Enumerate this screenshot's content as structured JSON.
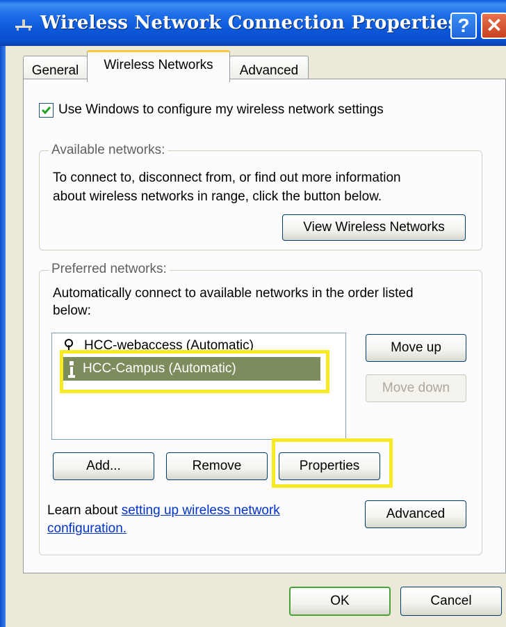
{
  "window": {
    "title": "Wireless Network Connection Properties",
    "help_glyph": "?",
    "close_glyph": "✕"
  },
  "tabs": [
    {
      "label": "General",
      "active": false
    },
    {
      "label": "Wireless Networks",
      "active": true
    },
    {
      "label": "Advanced",
      "active": false
    }
  ],
  "config_checkbox": {
    "label": "Use Windows to configure my wireless network settings",
    "checked": true
  },
  "available": {
    "legend": "Available networks:",
    "line1": "To connect to, disconnect from, or find out more information",
    "line2": "about wireless networks in range, click the button below.",
    "button": "View Wireless Networks"
  },
  "preferred": {
    "legend": "Preferred networks:",
    "line1": "Automatically connect to available networks in the order listed",
    "line2": "below:",
    "networks": [
      {
        "name": "HCC-webaccess (Automatic)",
        "icon": "network-signal-icon",
        "selected": false
      },
      {
        "name": "HCC-Campus (Automatic)",
        "icon": "network-antenna-icon",
        "selected": true
      }
    ],
    "move_up": "Move up",
    "move_down": "Move down",
    "add": "Add...",
    "remove": "Remove",
    "properties": "Properties",
    "learn_prefix": "Learn about ",
    "learn_link_line1": "setting up wireless network",
    "learn_link_line2": "configuration.",
    "advanced": "Advanced"
  },
  "footer": {
    "ok": "OK",
    "cancel": "Cancel"
  },
  "colors": {
    "title_bar": "#0a5ddf",
    "selection": "#7d8c5c",
    "highlight_box": "#f7e922",
    "tab_accent": "#ffc83c"
  }
}
